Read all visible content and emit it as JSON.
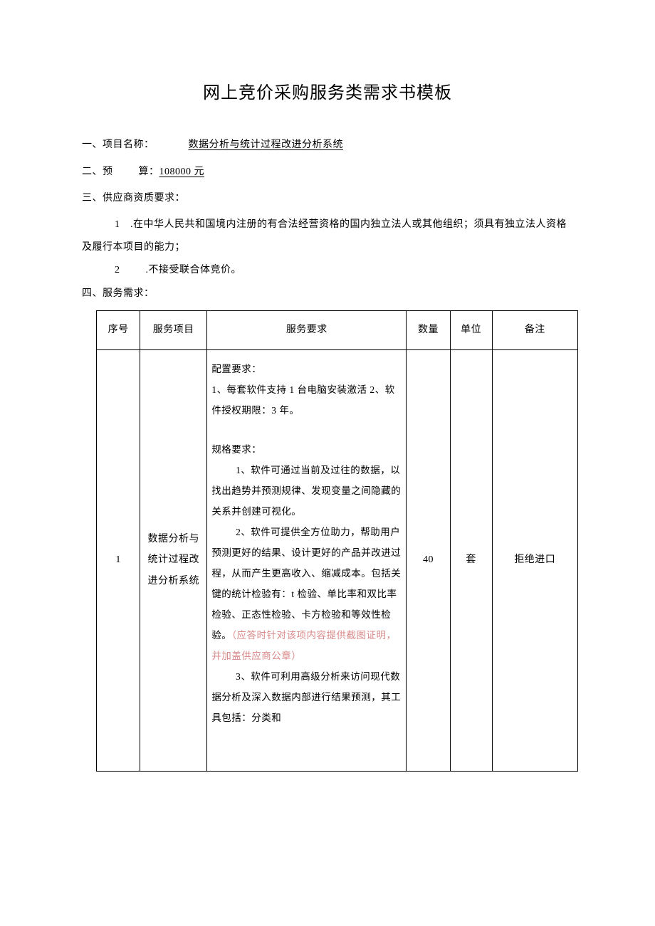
{
  "title": "网上竞价采购服务类需求书模板",
  "sections": {
    "s1": {
      "label": "一、项目名称：",
      "value": "数据分析与统计过程改进分析系统"
    },
    "s2": {
      "label": "二、预",
      "label2": "算：",
      "value": "108000 元"
    },
    "s3": {
      "label": "三、供应商资质要求："
    },
    "s3_items": {
      "i1": {
        "num": "1",
        "text": ".在中华人民共和国境内注册的有合法经营资格的国内独立法人或其他组织；须具有独立法人资格及履行本项目的能力；"
      },
      "i2": {
        "num": "2",
        "text": ".不接受联合体竞价。"
      }
    },
    "s4": {
      "label": "四、服务需求："
    }
  },
  "table": {
    "headers": {
      "seq": "序号",
      "proj": "服务项目",
      "req": "服务要求",
      "qty": "数量",
      "unit": "单位",
      "note": "备注"
    },
    "row1": {
      "seq": "1",
      "proj": "数据分析与统计过程改进分析系统",
      "qty": "40",
      "unit": "套",
      "note": "拒绝进口",
      "req": {
        "p1": "配置要求：",
        "p2": "1、每套软件支持 1 台电脑安装激活 2、软件授权期限：3 年。",
        "p3": "规格要求：",
        "p4": "1、软件可通过当前及过往的数据，以找出趋势并预测规律、发现变量之间隐藏的关系并创建可视化。",
        "p5a": "2、软件可提供全方位助力，帮助用户预测更好的结果、设计更好的产品并改进过程，从而产生更高收入、缩减成本。包括关键的统计检验有：t 检验、单比率和双比率检验、正态性检验、卡方检验和等效性检验。",
        "p5b": "（应答时针对该项内容提供截图证明，并加盖供应商公章）",
        "p6": "3、软件可利用高级分析来访问现代数据分析及深入数据内部进行结果预测，其工具包括：分类和"
      }
    }
  }
}
